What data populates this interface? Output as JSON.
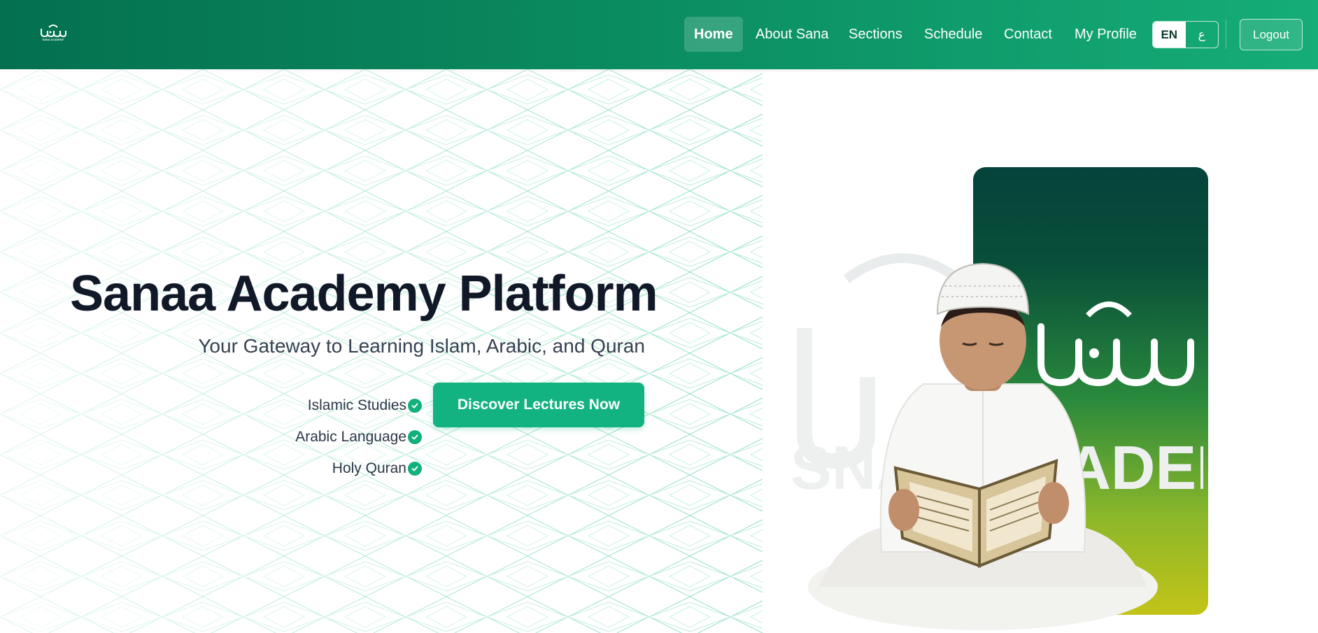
{
  "nav": {
    "logo_caption": "SANA ACADEMY",
    "items": [
      {
        "label": "Home",
        "active": true
      },
      {
        "label": "About Sana"
      },
      {
        "label": "Sections"
      },
      {
        "label": "Schedule"
      },
      {
        "label": "Contact"
      },
      {
        "label": "My Profile"
      }
    ],
    "lang": {
      "en": "EN",
      "ar": "ع"
    },
    "logout": "Logout"
  },
  "hero": {
    "title": "Sanaa Academy Platform",
    "subtitle": "Your Gateway to Learning Islam, Arabic, and Quran",
    "features": [
      "Islamic Studies",
      "Arabic Language",
      "Holy Quran"
    ],
    "cta": "Discover Lectures Now",
    "watermark_text": "SNAA ACADEMY"
  },
  "colors": {
    "nav_gradient_start": "#04704f",
    "nav_gradient_end": "#15ad78",
    "accent": "#12b380",
    "title": "#111827",
    "card_top": "#04433b",
    "card_bottom": "#c3c418"
  },
  "icons": [
    "sana-logo-icon",
    "check-circle-icon",
    "mosque-dome-icon"
  ]
}
